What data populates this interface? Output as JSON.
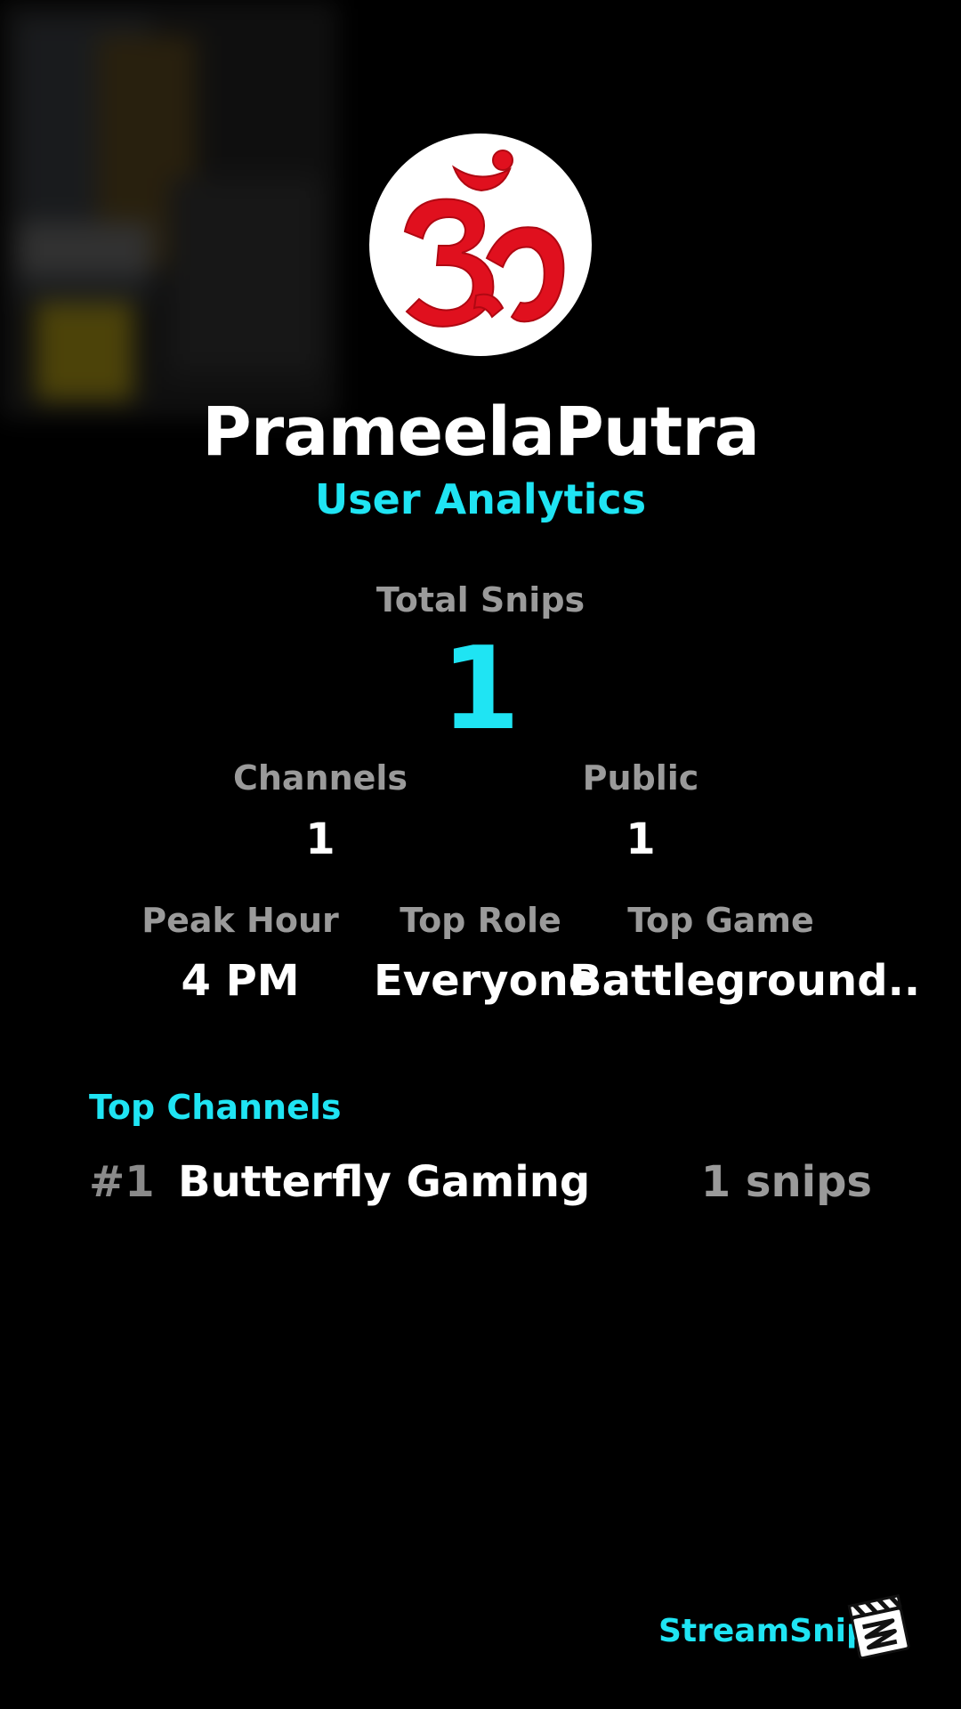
{
  "profile": {
    "username": "PrameelaPutra",
    "subtitle": "User Analytics",
    "avatar_icon": "om-symbol-icon"
  },
  "stats": {
    "total_snips_label": "Total Snips",
    "total_snips_value": "1",
    "channels_label": "Channels",
    "channels_value": "1",
    "public_label": "Public",
    "public_value": "1",
    "peak_hour_label": "Peak Hour",
    "peak_hour_value": "4 PM",
    "top_role_label": "Top Role",
    "top_role_value": "Everyone",
    "top_game_label": "Top Game",
    "top_game_value": "Battleground.."
  },
  "top_channels": {
    "heading": "Top Channels",
    "items": [
      {
        "rank": "#1",
        "name": "Butterfly Gaming",
        "count": "1 snips"
      }
    ]
  },
  "footer": {
    "brand": "StreamSnip",
    "logo_icon": "clapperboard-icon"
  },
  "colors": {
    "accent": "#1fe4f3",
    "label": "#9a9a9a",
    "background": "#000000",
    "om_red": "#e0101e"
  }
}
